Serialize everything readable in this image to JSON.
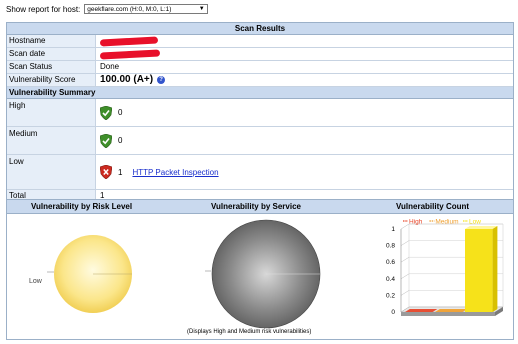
{
  "hostbar": {
    "label": "Show report for host:",
    "selected": "geekflare.com (H:0, M:0, L:1)"
  },
  "results": {
    "title": "Scan Results",
    "hostname_label": "Hostname",
    "scan_date_label": "Scan date",
    "scan_status_label": "Scan Status",
    "scan_status_value": "Done",
    "score_label": "Vulnerability Score",
    "score_value": "100.00 (A+)",
    "summary_title": "Vulnerability Summary",
    "high_label": "High",
    "high_count": "0",
    "medium_label": "Medium",
    "medium_count": "0",
    "low_label": "Low",
    "low_count": "1",
    "low_link": "HTTP Packet Inspection",
    "total_label": "Total",
    "total_count": "1"
  },
  "charts": {
    "risk_title": "Vulnerability by Risk Level",
    "service_title": "Vulnerability by Service",
    "count_title": "Vulnerability Count",
    "risk_pie_label": "Low",
    "service_note": "(Displays High and Medium risk vulnerabilities)"
  },
  "chart_data": {
    "type": "bar",
    "title": "Vulnerability Count",
    "categories": [
      "High",
      "Medium",
      "Low"
    ],
    "values": [
      0,
      0,
      1
    ],
    "ylim": [
      0,
      1
    ],
    "yticks": [
      "0",
      "0.2",
      "0.4",
      "0.6",
      "0.8",
      "1"
    ],
    "legend": [
      "High",
      "Medium",
      "Low"
    ],
    "legend_position": "top",
    "colors": {
      "High": "#e8472a",
      "Medium": "#f0a030",
      "Low": "#f6e21a"
    }
  },
  "colors": {
    "header_bg": "#c9d9ee",
    "label_bg": "#e6eef8",
    "link": "#1a2fcc",
    "shield_green": "#3f8f2a",
    "shield_red": "#cc2a20"
  }
}
